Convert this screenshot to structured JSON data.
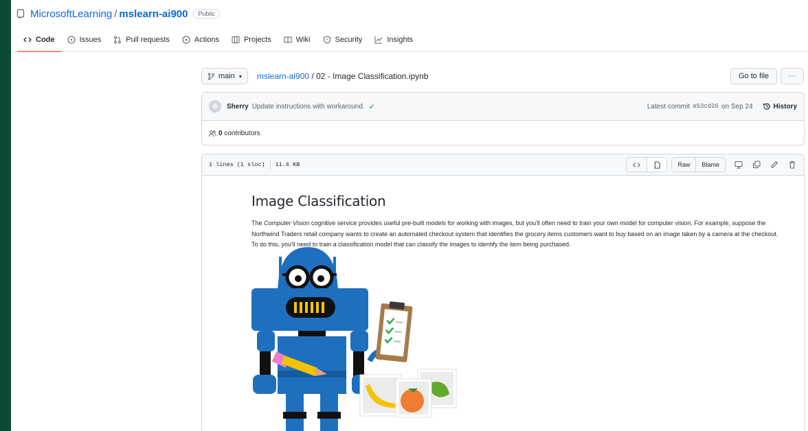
{
  "repo": {
    "owner": "MicrosoftLearning",
    "separator": "/",
    "name": "mslearn-ai900",
    "visibility": "Public"
  },
  "tabs": [
    {
      "label": "Code",
      "icon": "code-icon"
    },
    {
      "label": "Issues",
      "icon": "issue-icon"
    },
    {
      "label": "Pull requests",
      "icon": "pull-request-icon"
    },
    {
      "label": "Actions",
      "icon": "play-icon"
    },
    {
      "label": "Projects",
      "icon": "table-icon"
    },
    {
      "label": "Wiki",
      "icon": "book-icon"
    },
    {
      "label": "Security",
      "icon": "shield-icon"
    },
    {
      "label": "Insights",
      "icon": "graph-icon"
    }
  ],
  "branch": {
    "label": "main"
  },
  "breadcrumb": {
    "repo": "mslearn-ai900",
    "separator": "/",
    "file": "02 - Image Classification.ipynb"
  },
  "buttons": {
    "goto_file": "Go to file",
    "more": "···"
  },
  "commit": {
    "author": "Sherry",
    "message": "Update instructions with workaround.",
    "status": "✓",
    "prefix": "Latest commit",
    "sha": "a53cd26",
    "date": "on Sep 24",
    "history": "History"
  },
  "contributors": {
    "count": "0",
    "label": "contributors"
  },
  "file": {
    "lines": "1 lines (1 sloc)",
    "size": "11.6 KB",
    "raw": "Raw",
    "blame": "Blame"
  },
  "notebook": {
    "title": "Image Classification",
    "intro_the": "The ",
    "intro_em": "Computer Vision",
    "intro_rest": " cognitive service provides useful pre-built models for working with images, but you'll often need to train your own model for computer vision. For example, suppose the Northwind Traders retail company wants to create an automated checkout system that identifies the grocery items customers want to buy based on an image taken by a camera at the checkout. To do this, you'll need to train a classification model that can classify the images to identify the item being purchased."
  },
  "colors": {
    "link": "#0969da",
    "active_tab": "#fd8c73",
    "robot_blue": "#1f6fbf",
    "border_outside": "#0b4a33"
  }
}
